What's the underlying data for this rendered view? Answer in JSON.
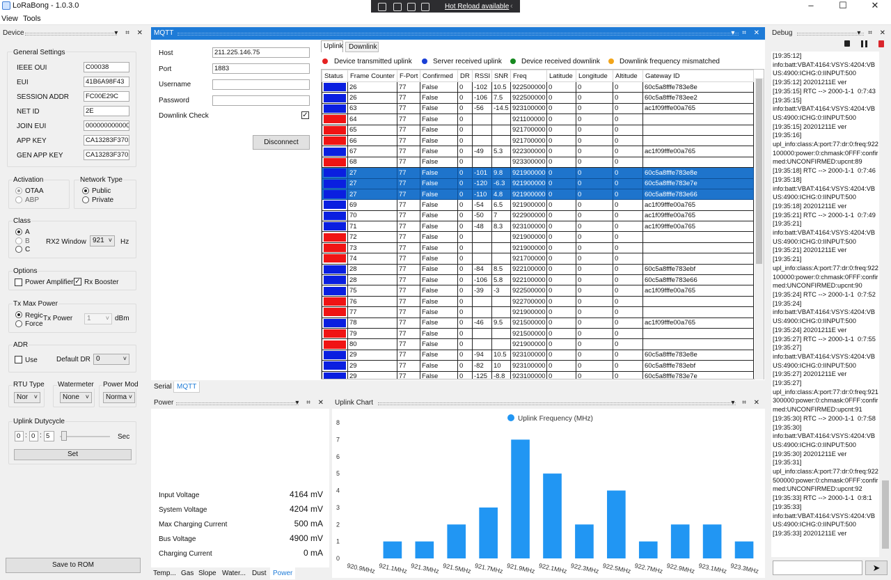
{
  "app": {
    "title": "LoRaBong - 1.0.3.0"
  },
  "devtools": {
    "hot_reload": "Hot Reload available"
  },
  "menu": {
    "view": "View",
    "tools": "Tools"
  },
  "device": {
    "panel_title": "Device",
    "general": {
      "title": "General Settings",
      "fields": [
        {
          "label": "IEEE OUI",
          "value": "C00038"
        },
        {
          "label": "EUI",
          "value": "41B6A98F43"
        },
        {
          "label": "SESSION ADDR",
          "value": "FC00E29C"
        },
        {
          "label": "NET ID",
          "value": "2E"
        },
        {
          "label": "JOIN EUI",
          "value": "000000000000"
        },
        {
          "label": "APP KEY",
          "value": "CA13283F3702"
        },
        {
          "label": "GEN APP KEY",
          "value": "CA13283F3702"
        }
      ]
    },
    "activation": {
      "title": "Activation",
      "otaa": "OTAA",
      "abp": "ABP"
    },
    "network": {
      "title": "Network Type",
      "public": "Public",
      "private": "Private"
    },
    "cls": {
      "title": "Class",
      "a": "A",
      "b": "B",
      "c": "C",
      "rx2_label": "RX2 Window",
      "rx2_value": "921",
      "unit": "Hz"
    },
    "options": {
      "title": "Options",
      "power_amp": "Power Amplifier",
      "rx_booster": "Rx Booster"
    },
    "txmax": {
      "title": "Tx Max Power",
      "regional": "Regic",
      "forced": "Force",
      "tx_label": "Tx Power",
      "tx_value": "1",
      "unit": "dBm"
    },
    "adr": {
      "title": "ADR",
      "use": "Use",
      "default_dr_label": "Default DR",
      "default_dr_value": "0"
    },
    "rtu": {
      "title": "RTU Type",
      "value": "Nor"
    },
    "watermeter": {
      "title": "Watermeter",
      "value": "None"
    },
    "powermode": {
      "title": "Power Mod",
      "value": "Norma"
    },
    "duty": {
      "title": "Uplink Dutycycle",
      "h": "0",
      "m": "0",
      "s": "5",
      "sep": ":",
      "unit": "Sec",
      "set": "Set"
    },
    "save_rom": "Save to ROM"
  },
  "mqtt": {
    "panel_title": "MQTT",
    "host_label": "Host",
    "host": "211.225.146.75",
    "port_label": "Port",
    "port": "1883",
    "username_label": "Username",
    "username": "",
    "password_label": "Password",
    "password": "",
    "downlink_check": "Downlink Check",
    "disconnect": "Disconnect",
    "tabs": {
      "uplink": "Uplink",
      "downlink": "Downlink"
    },
    "legend": [
      {
        "text": "Device transmitted uplink",
        "color": "#e52222"
      },
      {
        "text": "Server received uplink",
        "color": "#1a3fd6"
      },
      {
        "text": "Device received downlink",
        "color": "#16891f"
      },
      {
        "text": "Downlink frequency mismatched",
        "color": "#f2a51a"
      }
    ],
    "columns": [
      "Status",
      "Frame Counter",
      "F-Port",
      "Confirmed",
      "DR",
      "RSSI",
      "SNR",
      "Freq",
      "Latitude",
      "Longitude",
      "Altitude",
      "Gateway ID"
    ],
    "rows": [
      {
        "color": "#0a1fe0",
        "fc": "26",
        "fp": "77",
        "cf": "False",
        "dr": "0",
        "rssi": "-102",
        "snr": "10.5",
        "freq": "922500000",
        "lat": "0",
        "lon": "0",
        "alt": "0",
        "gw": "60c5a8fffe783e8e",
        "sel": false
      },
      {
        "color": "#0a1fe0",
        "fc": "26",
        "fp": "77",
        "cf": "False",
        "dr": "0",
        "rssi": "-106",
        "snr": "7.5",
        "freq": "922500000",
        "lat": "0",
        "lon": "0",
        "alt": "0",
        "gw": "60c5a8fffe783ee2",
        "sel": false
      },
      {
        "color": "#0a1fe0",
        "fc": "63",
        "fp": "77",
        "cf": "False",
        "dr": "0",
        "rssi": "-56",
        "snr": "-14.5",
        "freq": "923100000",
        "lat": "0",
        "lon": "0",
        "alt": "0",
        "gw": "ac1f09fffe00a765",
        "sel": false
      },
      {
        "color": "#f01414",
        "fc": "64",
        "fp": "77",
        "cf": "False",
        "dr": "0",
        "rssi": "",
        "snr": "",
        "freq": "921100000",
        "lat": "0",
        "lon": "0",
        "alt": "0",
        "gw": "",
        "sel": false
      },
      {
        "color": "#f01414",
        "fc": "65",
        "fp": "77",
        "cf": "False",
        "dr": "0",
        "rssi": "",
        "snr": "",
        "freq": "921700000",
        "lat": "0",
        "lon": "0",
        "alt": "0",
        "gw": "",
        "sel": false
      },
      {
        "color": "#f01414",
        "fc": "66",
        "fp": "77",
        "cf": "False",
        "dr": "0",
        "rssi": "",
        "snr": "",
        "freq": "921700000",
        "lat": "0",
        "lon": "0",
        "alt": "0",
        "gw": "",
        "sel": false
      },
      {
        "color": "#0a1fe0",
        "fc": "67",
        "fp": "77",
        "cf": "False",
        "dr": "0",
        "rssi": "-49",
        "snr": "5.3",
        "freq": "922300000",
        "lat": "0",
        "lon": "0",
        "alt": "0",
        "gw": "ac1f09fffe00a765",
        "sel": false
      },
      {
        "color": "#f01414",
        "fc": "68",
        "fp": "77",
        "cf": "False",
        "dr": "0",
        "rssi": "",
        "snr": "",
        "freq": "923300000",
        "lat": "0",
        "lon": "0",
        "alt": "0",
        "gw": "",
        "sel": false
      },
      {
        "color": "#0a1fe0",
        "fc": "27",
        "fp": "77",
        "cf": "False",
        "dr": "0",
        "rssi": "-101",
        "snr": "9.8",
        "freq": "921900000",
        "lat": "0",
        "lon": "0",
        "alt": "0",
        "gw": "60c5a8fffe783e8e",
        "sel": true
      },
      {
        "color": "#0a1fe0",
        "fc": "27",
        "fp": "77",
        "cf": "False",
        "dr": "0",
        "rssi": "-120",
        "snr": "-6.3",
        "freq": "921900000",
        "lat": "0",
        "lon": "0",
        "alt": "0",
        "gw": "60c5a8fffe783e7e",
        "sel": true
      },
      {
        "color": "#0a1fe0",
        "fc": "27",
        "fp": "77",
        "cf": "False",
        "dr": "0",
        "rssi": "-110",
        "snr": "4.8",
        "freq": "921900000",
        "lat": "0",
        "lon": "0",
        "alt": "0",
        "gw": "60c5a8fffe783e66",
        "sel": true
      },
      {
        "color": "#0a1fe0",
        "fc": "69",
        "fp": "77",
        "cf": "False",
        "dr": "0",
        "rssi": "-54",
        "snr": "6.5",
        "freq": "921900000",
        "lat": "0",
        "lon": "0",
        "alt": "0",
        "gw": "ac1f09fffe00a765",
        "sel": false
      },
      {
        "color": "#0a1fe0",
        "fc": "70",
        "fp": "77",
        "cf": "False",
        "dr": "0",
        "rssi": "-50",
        "snr": "7",
        "freq": "922900000",
        "lat": "0",
        "lon": "0",
        "alt": "0",
        "gw": "ac1f09fffe00a765",
        "sel": false
      },
      {
        "color": "#0a1fe0",
        "fc": "71",
        "fp": "77",
        "cf": "False",
        "dr": "0",
        "rssi": "-48",
        "snr": "8.3",
        "freq": "923100000",
        "lat": "0",
        "lon": "0",
        "alt": "0",
        "gw": "ac1f09fffe00a765",
        "sel": false
      },
      {
        "color": "#f01414",
        "fc": "72",
        "fp": "77",
        "cf": "False",
        "dr": "0",
        "rssi": "",
        "snr": "",
        "freq": "921900000",
        "lat": "0",
        "lon": "0",
        "alt": "0",
        "gw": "",
        "sel": false
      },
      {
        "color": "#f01414",
        "fc": "73",
        "fp": "77",
        "cf": "False",
        "dr": "0",
        "rssi": "",
        "snr": "",
        "freq": "921900000",
        "lat": "0",
        "lon": "0",
        "alt": "0",
        "gw": "",
        "sel": false
      },
      {
        "color": "#f01414",
        "fc": "74",
        "fp": "77",
        "cf": "False",
        "dr": "0",
        "rssi": "",
        "snr": "",
        "freq": "921700000",
        "lat": "0",
        "lon": "0",
        "alt": "0",
        "gw": "",
        "sel": false
      },
      {
        "color": "#0a1fe0",
        "fc": "28",
        "fp": "77",
        "cf": "False",
        "dr": "0",
        "rssi": "-84",
        "snr": "8.5",
        "freq": "922100000",
        "lat": "0",
        "lon": "0",
        "alt": "0",
        "gw": "60c5a8fffe783ebf",
        "sel": false
      },
      {
        "color": "#0a1fe0",
        "fc": "28",
        "fp": "77",
        "cf": "False",
        "dr": "0",
        "rssi": "-106",
        "snr": "5.8",
        "freq": "922100000",
        "lat": "0",
        "lon": "0",
        "alt": "0",
        "gw": "60c5a8fffe783e66",
        "sel": false
      },
      {
        "color": "#0a1fe0",
        "fc": "75",
        "fp": "77",
        "cf": "False",
        "dr": "0",
        "rssi": "-39",
        "snr": "-3",
        "freq": "922500000",
        "lat": "0",
        "lon": "0",
        "alt": "0",
        "gw": "ac1f09fffe00a765",
        "sel": false
      },
      {
        "color": "#f01414",
        "fc": "76",
        "fp": "77",
        "cf": "False",
        "dr": "0",
        "rssi": "",
        "snr": "",
        "freq": "922700000",
        "lat": "0",
        "lon": "0",
        "alt": "0",
        "gw": "",
        "sel": false
      },
      {
        "color": "#f01414",
        "fc": "77",
        "fp": "77",
        "cf": "False",
        "dr": "0",
        "rssi": "",
        "snr": "",
        "freq": "921900000",
        "lat": "0",
        "lon": "0",
        "alt": "0",
        "gw": "",
        "sel": false
      },
      {
        "color": "#0a1fe0",
        "fc": "78",
        "fp": "77",
        "cf": "False",
        "dr": "0",
        "rssi": "-46",
        "snr": "9.5",
        "freq": "921500000",
        "lat": "0",
        "lon": "0",
        "alt": "0",
        "gw": "ac1f09fffe00a765",
        "sel": false
      },
      {
        "color": "#f01414",
        "fc": "79",
        "fp": "77",
        "cf": "False",
        "dr": "0",
        "rssi": "",
        "snr": "",
        "freq": "921500000",
        "lat": "0",
        "lon": "0",
        "alt": "0",
        "gw": "",
        "sel": false
      },
      {
        "color": "#f01414",
        "fc": "80",
        "fp": "77",
        "cf": "False",
        "dr": "0",
        "rssi": "",
        "snr": "",
        "freq": "921900000",
        "lat": "0",
        "lon": "0",
        "alt": "0",
        "gw": "",
        "sel": false
      },
      {
        "color": "#0a1fe0",
        "fc": "29",
        "fp": "77",
        "cf": "False",
        "dr": "0",
        "rssi": "-94",
        "snr": "10.5",
        "freq": "923100000",
        "lat": "0",
        "lon": "0",
        "alt": "0",
        "gw": "60c5a8fffe783e8e",
        "sel": false
      },
      {
        "color": "#0a1fe0",
        "fc": "29",
        "fp": "77",
        "cf": "False",
        "dr": "0",
        "rssi": "-82",
        "snr": "10",
        "freq": "923100000",
        "lat": "0",
        "lon": "0",
        "alt": "0",
        "gw": "60c5a8fffe783ebf",
        "sel": false
      },
      {
        "color": "#0a1fe0",
        "fc": "29",
        "fp": "77",
        "cf": "False",
        "dr": "0",
        "rssi": "-125",
        "snr": "-8.8",
        "freq": "923100000",
        "lat": "0",
        "lon": "0",
        "alt": "0",
        "gw": "60c5a8fffe783e7e",
        "sel": false
      }
    ]
  },
  "bottom_tabs": {
    "serial": "Serial",
    "mqtt": "MQTT"
  },
  "power": {
    "panel_title": "Power",
    "rows": [
      {
        "label": "Input Voltage",
        "value": "4164 mV"
      },
      {
        "label": "System Voltage",
        "value": "4204 mV"
      },
      {
        "label": "Max Charging Current",
        "value": "500 mA"
      },
      {
        "label": "Bus Voltage",
        "value": "4900 mV"
      },
      {
        "label": "Charging Current",
        "value": "0 mA"
      }
    ],
    "tabs": [
      "Temp...",
      "Gas",
      "Slope",
      "Water...",
      "Dust",
      "Power"
    ]
  },
  "uplink_chart": {
    "panel_title": "Uplink Chart"
  },
  "chart_data": {
    "type": "bar",
    "legend": "Uplink Frequency (MHz)",
    "color": "#2196f3",
    "categories": [
      "920.9MHz",
      "921.1MHz",
      "921.3MHz",
      "921.5MHz",
      "921.7MHz",
      "921.9MHz",
      "922.1MHz",
      "922.3MHz",
      "922.5MHz",
      "922.7MHz",
      "922.9MHz",
      "923.1MHz",
      "923.3MHz"
    ],
    "values": [
      0,
      1,
      1,
      2,
      3,
      7,
      5,
      2,
      4,
      1,
      2,
      2,
      1
    ],
    "ylim": [
      0,
      8
    ],
    "yticks": [
      "0",
      "1",
      "2",
      "3",
      "4",
      "5",
      "6",
      "7",
      "8"
    ],
    "grid": false
  },
  "debug": {
    "panel_title": "Debug",
    "lines": [
      "[19:35:12]",
      "info:batt:VBAT:4164:VSYS:4204:VBUS:4900:ICHG:0:IINPUT:500",
      "[19:35:12] 20201211E ver",
      "[19:35:15] RTC --> 2000-1-1  0:7:43",
      "[19:35:15]",
      "info:batt:VBAT:4164:VSYS:4204:VBUS:4900:ICHG:0:IINPUT:500",
      "[19:35:15] 20201211E ver",
      "[19:35:16]",
      "upl_info:class:A:port:77:dr:0:freq:922100000:power:0:chmask:0FFF:confirmed:UNCONFIRMED:upcnt:89",
      "[19:35:18] RTC --> 2000-1-1  0:7:46",
      "[19:35:18]",
      "info:batt:VBAT:4164:VSYS:4204:VBUS:4900:ICHG:0:IINPUT:500",
      "[19:35:18] 20201211E ver",
      "[19:35:21] RTC --> 2000-1-1  0:7:49",
      "[19:35:21]",
      "info:batt:VBAT:4164:VSYS:4204:VBUS:4900:ICHG:0:IINPUT:500",
      "[19:35:21] 20201211E ver",
      "[19:35:21]",
      "upl_info:class:A:port:77:dr:0:freq:922100000:power:0:chmask:0FFF:confirmed:UNCONFIRMED:upcnt:90",
      "[19:35:24] RTC --> 2000-1-1  0:7:52",
      "[19:35:24]",
      "info:batt:VBAT:4164:VSYS:4204:VBUS:4900:ICHG:0:IINPUT:500",
      "[19:35:24] 20201211E ver",
      "[19:35:27] RTC --> 2000-1-1  0:7:55",
      "[19:35:27]",
      "info:batt:VBAT:4164:VSYS:4204:VBUS:4900:ICHG:0:IINPUT:500",
      "[19:35:27] 20201211E ver",
      "[19:35:27]",
      "upl_info:class:A:port:77:dr:0:freq:921300000:power:0:chmask:0FFF:confirmed:UNCONFIRMED:upcnt:91",
      "[19:35:30] RTC --> 2000-1-1  0:7:58",
      "[19:35:30]",
      "info:batt:VBAT:4164:VSYS:4204:VBUS:4900:ICHG:0:IINPUT:500",
      "[19:35:30] 20201211E ver",
      "[19:35:31]",
      "upl_info:class:A:port:77:dr:0:freq:922500000:power:0:chmask:0FFF:confirmed:UNCONFIRMED:upcnt:92",
      "[19:35:33] RTC --> 2000-1-1  0:8:1",
      "[19:35:33]",
      "info:batt:VBAT:4164:VSYS:4204:VBUS:4900:ICHG:0:IINPUT:500",
      "[19:35:33] 20201211E ver"
    ]
  }
}
